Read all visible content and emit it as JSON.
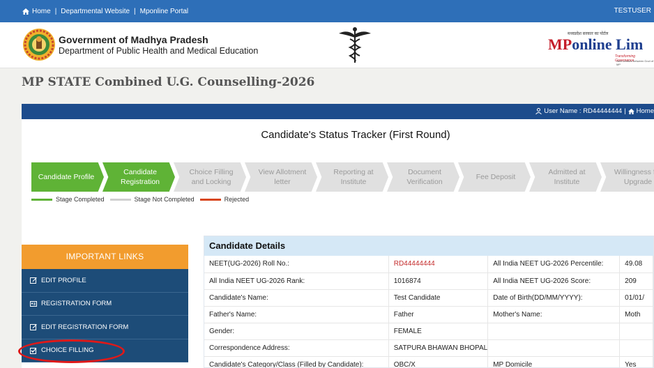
{
  "topbar": {
    "links": [
      "Home",
      "Departmental Website",
      "Mponline Portal"
    ],
    "separator": "|",
    "user": "TESTUSER"
  },
  "header": {
    "org_title": "Government of Madhya Pradesh",
    "org_subtitle": "Department of Public Health and Medical Education",
    "mponline": {
      "tagline": "मध्यप्रदेश सरकार का पोर्टल",
      "brand_mp": "MP",
      "brand_rest": "online Lim",
      "slogan": "Transforming Governance",
      "slogan2": "Joint venture between Govt of MP"
    }
  },
  "page_title": "MP STATE Combined U.G. Counselling-2026",
  "userbar": {
    "username_label": "User Name : RD44444444",
    "home_label": "Home"
  },
  "tracker": {
    "title": "Candidate's Status Tracker (First Round)",
    "stages": [
      {
        "label": "Candidate Profile",
        "status": "completed"
      },
      {
        "label": "Candidate Registration",
        "status": "completed"
      },
      {
        "label": "Choice Filling and Locking",
        "status": "not_completed"
      },
      {
        "label": "View Allotment letter",
        "status": "not_completed"
      },
      {
        "label": "Reporting at Institute",
        "status": "not_completed"
      },
      {
        "label": "Document Verification",
        "status": "not_completed"
      },
      {
        "label": "Fee Deposit",
        "status": "not_completed"
      },
      {
        "label": "Admitted at Institute",
        "status": "not_completed"
      },
      {
        "label": "Willingness for Upgrade",
        "status": "not_completed"
      }
    ],
    "legend": [
      {
        "label": "Stage Completed",
        "color": "#5fb336"
      },
      {
        "label": "Stage Not Completed",
        "color": "#cfcfcf"
      },
      {
        "label": "Rejected",
        "color": "#d8461e"
      }
    ]
  },
  "sidebar": {
    "title": "IMPORTANT LINKS",
    "items": [
      {
        "label": "EDIT PROFILE",
        "icon": "edit-icon"
      },
      {
        "label": "REGISTRATION FORM",
        "icon": "id-card-icon"
      },
      {
        "label": "EDIT REGISTRATION FORM",
        "icon": "edit-icon"
      },
      {
        "label": "CHOICE FILLING",
        "icon": "checkbox-icon"
      }
    ]
  },
  "details": {
    "title": "Candidate Details",
    "rows": [
      [
        "NEET(UG-2026) Roll No.:",
        "RD44444444",
        "All India NEET UG-2026 Percentile:",
        "49.08"
      ],
      [
        "All India NEET UG-2026 Rank:",
        "1016874",
        "All India NEET UG-2026 Score:",
        "209"
      ],
      [
        "Candidate's Name:",
        "Test Candidate",
        "Date of Birth(DD/MM/YYYY):",
        "01/01/"
      ],
      [
        "Father's Name:",
        "Father",
        "Mother's Name:",
        "Moth"
      ],
      [
        "Gender:",
        "FEMALE",
        "",
        ""
      ],
      [
        "Correspondence Address:",
        "SATPURA BHAWAN BHOPAL",
        "",
        ""
      ],
      [
        "Candidate's Category/Class (Filled by Candidate):",
        "OBC/X",
        "MP Domicile",
        "Yes"
      ]
    ]
  },
  "colors": {
    "topbar": "#2e6fb8",
    "userbar": "#1d4c8c",
    "sidebar_head": "#f29c2e",
    "sidebar_item": "#1d4c78",
    "completed": "#5fb336",
    "highlight": "#e01919"
  }
}
